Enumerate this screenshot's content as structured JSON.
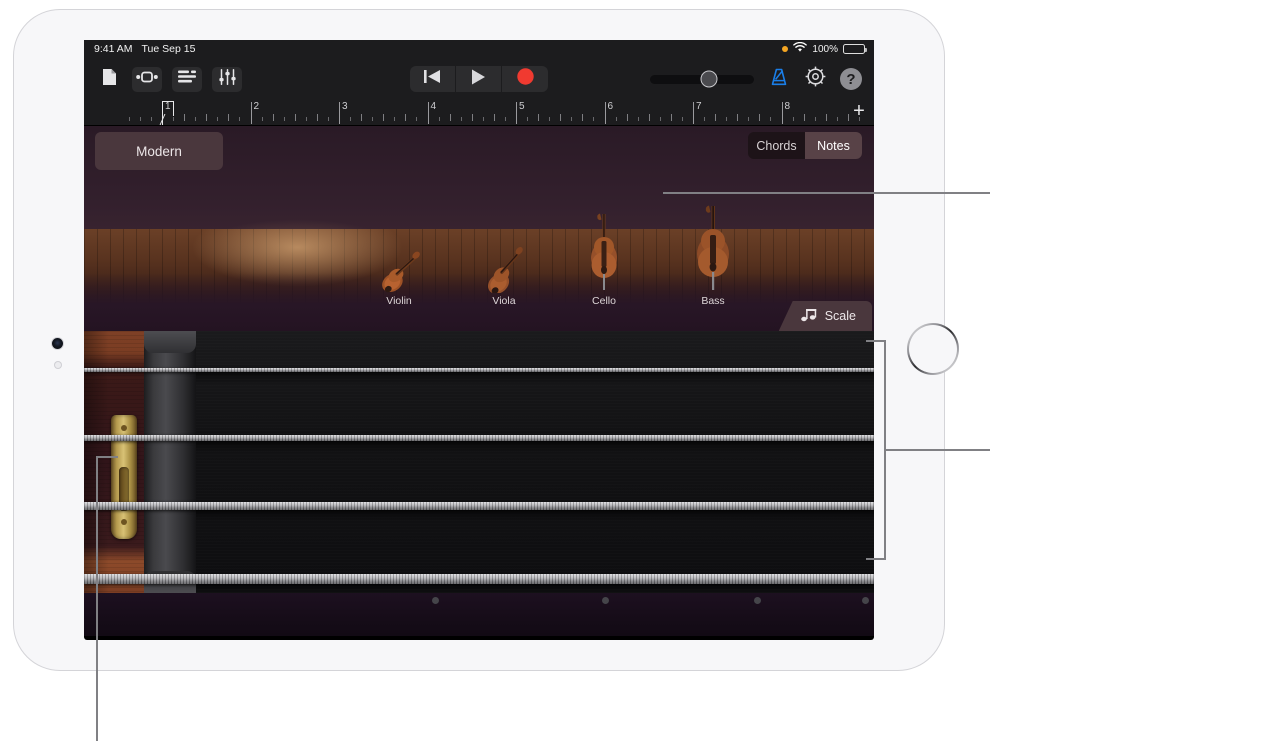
{
  "device": {
    "name": "iPad",
    "camera": "front-camera",
    "home_button": "home-button"
  },
  "status_bar": {
    "time": "9:41 AM",
    "date": "Tue Sep 15",
    "recording_indicator": "orange-dot",
    "wifi": "wifi-icon",
    "battery_percent": "100%",
    "battery_icon": "battery-full-icon"
  },
  "toolbar": {
    "left_buttons": [
      {
        "name": "my-songs-button",
        "icon": "document-icon"
      },
      {
        "name": "loop-browser-button",
        "icon": "cycle-icon"
      },
      {
        "name": "track-view-button",
        "icon": "track-list-icon"
      },
      {
        "name": "mixer-button",
        "icon": "mixer-sliders-icon"
      }
    ],
    "transport": [
      {
        "name": "rewind-button",
        "icon": "rewind-icon"
      },
      {
        "name": "play-button",
        "icon": "play-icon"
      },
      {
        "name": "record-button",
        "icon": "record-icon"
      }
    ],
    "volume": {
      "name": "master-volume-slider",
      "value_percent": 57
    },
    "metronome": {
      "name": "metronome-button",
      "icon": "metronome-icon",
      "color": "#1a7ee8",
      "active": true
    },
    "settings": {
      "name": "settings-button",
      "icon": "gear-icon"
    },
    "help": {
      "name": "help-button",
      "icon": "question-mark-icon",
      "label": "?"
    }
  },
  "ruler": {
    "bars": [
      "1",
      "2",
      "3",
      "4",
      "5",
      "6",
      "7",
      "8"
    ],
    "playhead_bar": "1",
    "add_track_label": "+"
  },
  "stage": {
    "preset_button": {
      "name": "preset-modern-button",
      "label": "Modern"
    },
    "mode_toggle": {
      "options": [
        "Chords",
        "Notes"
      ],
      "selected": "Notes"
    },
    "instruments": [
      {
        "name": "instrument-violin",
        "label": "Violin",
        "selected": true
      },
      {
        "name": "instrument-viola",
        "label": "Viola",
        "selected": false
      },
      {
        "name": "instrument-cello",
        "label": "Cello",
        "selected": false
      },
      {
        "name": "instrument-bass",
        "label": "Bass",
        "selected": false
      }
    ],
    "scale_button": {
      "name": "scale-button",
      "label": "Scale",
      "icon": "double-eighth-note-icon"
    }
  },
  "fingerboard": {
    "strings": [
      {
        "name": "string-1",
        "thickness": 4
      },
      {
        "name": "string-2",
        "thickness": 6
      },
      {
        "name": "string-3",
        "thickness": 8
      },
      {
        "name": "string-4",
        "thickness": 10
      }
    ],
    "position_markers": 4,
    "parts": [
      "instrument-body",
      "tailpiece",
      "nut",
      "fingerboard-surface"
    ]
  },
  "colors": {
    "accent_blue": "#1a7ee8",
    "record_red": "#f03a30",
    "panel_brown": "#4a373d",
    "app_background": "#1a1118",
    "toolbar_background": "#1c1c1e"
  }
}
